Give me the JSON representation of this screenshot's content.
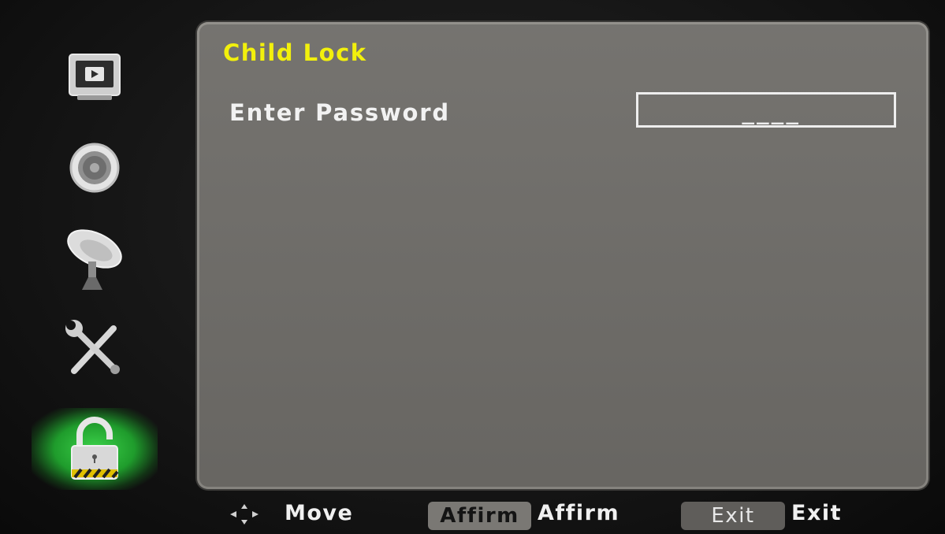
{
  "sidebar": {
    "items": [
      {
        "icon": "tv-icon",
        "active": false
      },
      {
        "icon": "speaker-icon",
        "active": false
      },
      {
        "icon": "satellite-dish-icon",
        "active": false
      },
      {
        "icon": "tools-icon",
        "active": false
      },
      {
        "icon": "lock-icon",
        "active": true
      }
    ]
  },
  "panel": {
    "title": "Child Lock",
    "field_label": "Enter Password",
    "password_value": "____"
  },
  "helpbar": {
    "move_label": "Move",
    "affirm_key": "Affirm",
    "affirm_label": "Affirm",
    "exit_key": "Exit",
    "exit_label": "Exit"
  },
  "colors": {
    "title": "#f2f000",
    "panel_bg": "#6e6c68",
    "active_item": "#2fbf3a"
  }
}
